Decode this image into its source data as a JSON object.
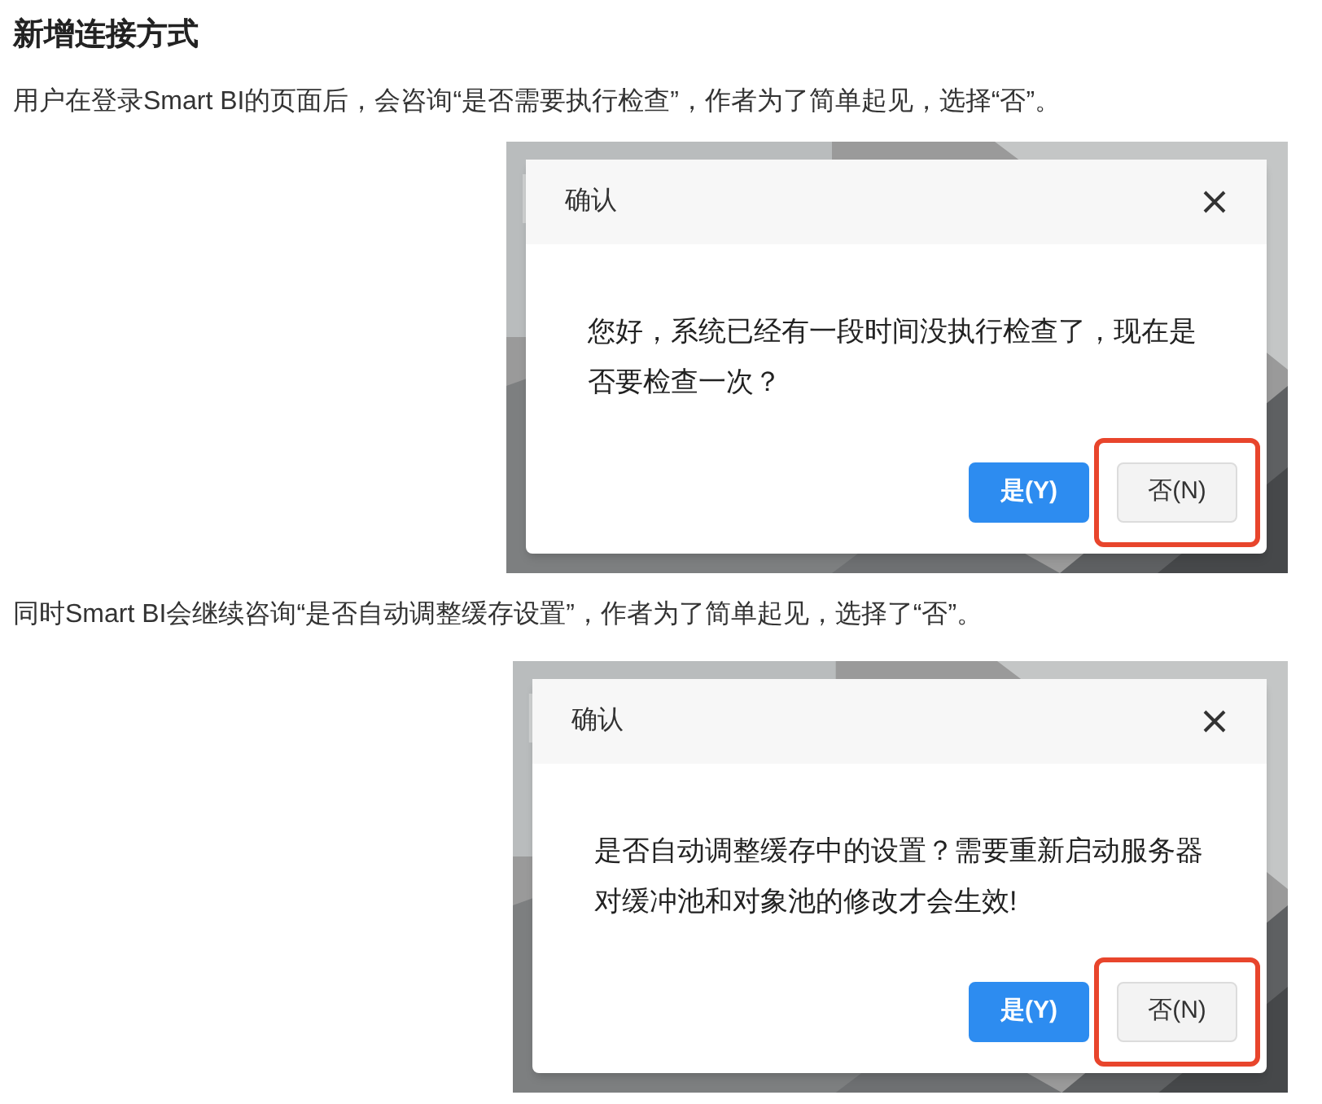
{
  "heading": "新增连接方式",
  "sections": [
    {
      "paragraph": "用户在登录Smart BI的页面后，会咨询“是否需要执行检查”，作者为了简单起见，选择“否”。",
      "screenshot": {
        "kind": "picture",
        "dialog": {
          "title": "确认",
          "message": "您好，系统已经有一段时间没执行检查了，现在是否要检查一次？",
          "buttons": [
            {
              "label": "是(Y)",
              "kind": "primary",
              "highlighted": false
            },
            {
              "label": "否(N)",
              "kind": "default",
              "highlighted": true
            }
          ]
        }
      }
    },
    {
      "paragraph": "同时Smart BI会继续咨询“是否自动调整缓存设置”，作者为了简单起见，选择了“否”。",
      "screenshot": {
        "kind": "picture",
        "dialog": {
          "title": "确认",
          "message": "是否自动调整缓存中的设置？需要重新启动服务器对缓冲池和对象池的修改才会生效!",
          "buttons": [
            {
              "label": "是(Y)",
              "kind": "primary",
              "highlighted": false
            },
            {
              "label": "否(N)",
              "kind": "default",
              "highlighted": true
            }
          ]
        }
      }
    }
  ]
}
